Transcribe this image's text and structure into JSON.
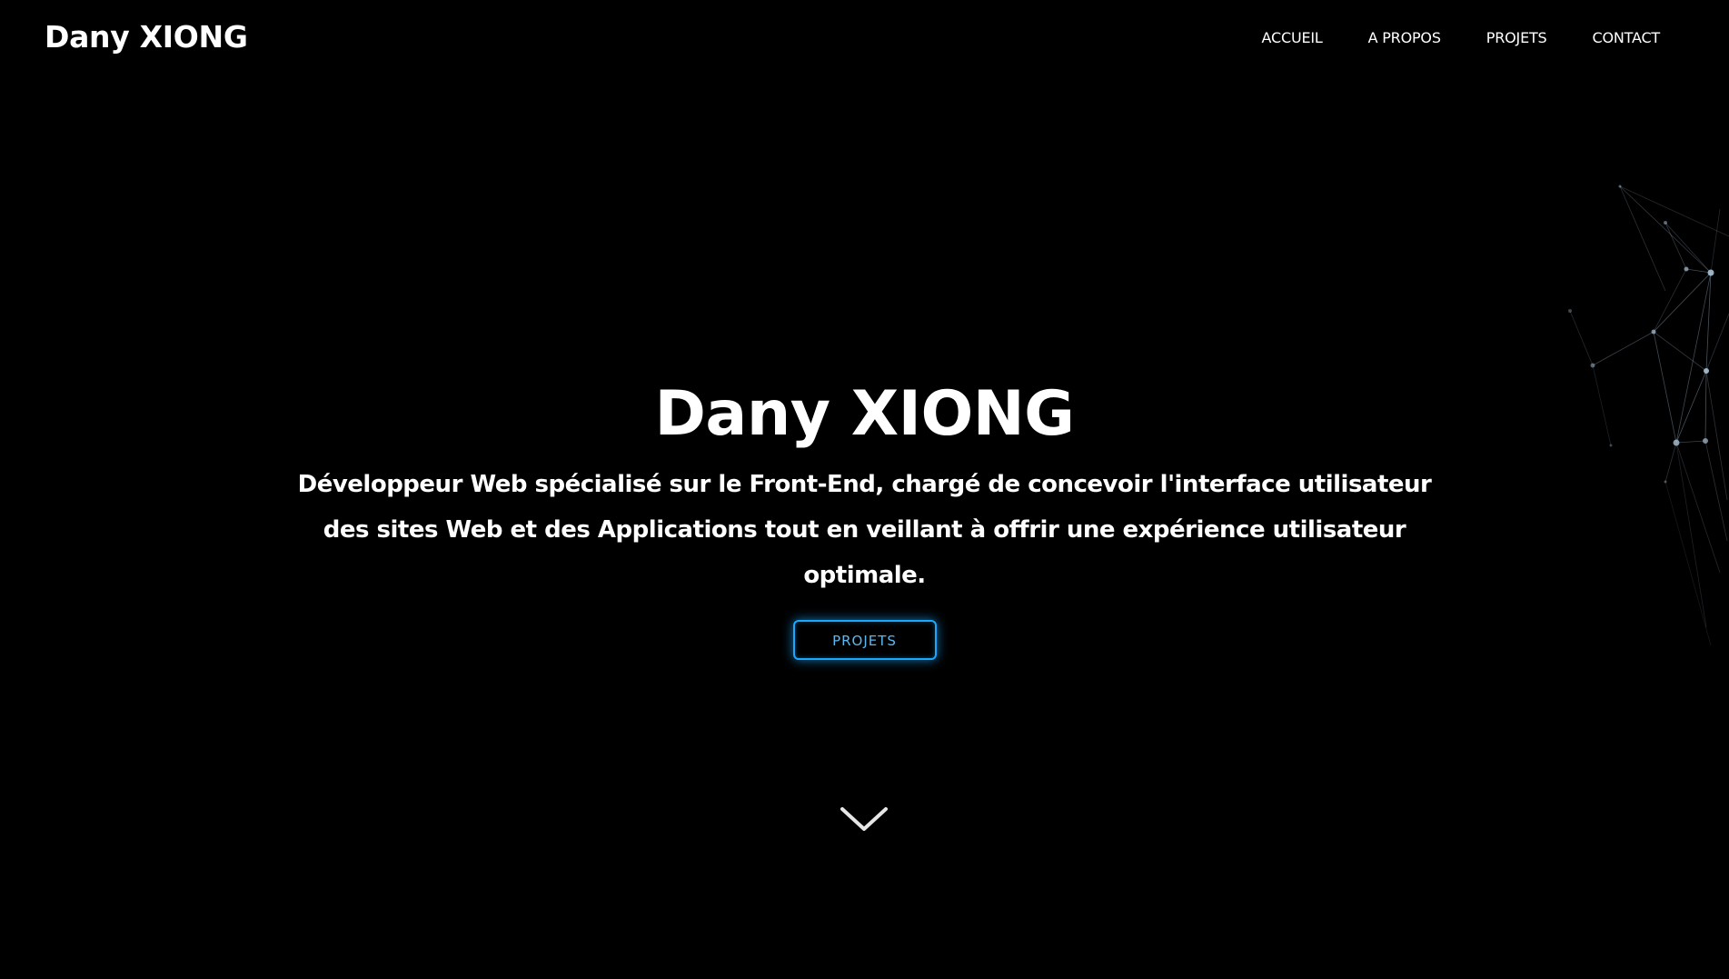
{
  "header": {
    "logo": "Dany XIONG",
    "nav": [
      "ACCUEIL",
      "A PROPOS",
      "PROJETS",
      "CONTACT"
    ]
  },
  "hero": {
    "title": "Dany XIONG",
    "description": "Développeur Web spécialisé sur le Front-End, chargé de concevoir l'interface utilisateur des sites Web et des Applications tout en veillant à offrir une expérience utilisateur optimale.",
    "button_label": "PROJETS"
  },
  "icons": {
    "scroll": "chevron-down-icon",
    "background": "particle-network"
  },
  "colors": {
    "background": "#000000",
    "text": "#ffffff",
    "accent": "#1aa8ff"
  }
}
